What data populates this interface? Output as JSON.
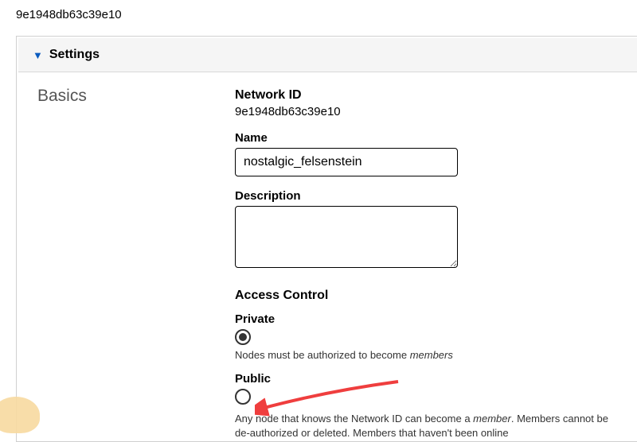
{
  "page_id": "9e1948db63c39e10",
  "settings_title": "Settings",
  "leftcol_title": "Basics",
  "network_id_label": "Network ID",
  "network_id_value": "9e1948db63c39e10",
  "name_label": "Name",
  "name_value": "nostalgic_felsenstein",
  "description_label": "Description",
  "description_value": "",
  "access_control_label": "Access Control",
  "private_label": "Private",
  "private_helper_before": "Nodes must be authorized to become ",
  "private_helper_em": "members",
  "public_label": "Public",
  "public_helper_before": "Any node that knows the Network ID can become a ",
  "public_helper_em": "member",
  "public_helper_after": ". Members cannot be de-authorized or deleted. Members that haven't been online"
}
